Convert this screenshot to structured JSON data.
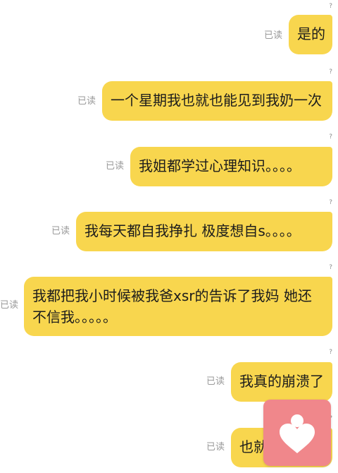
{
  "messages": [
    {
      "mark": "?",
      "status": "已读",
      "text": "是的"
    },
    {
      "mark": "?",
      "status": "已读",
      "text": "一个星期我也就也能见到我奶一次"
    },
    {
      "mark": "?",
      "status": "已读",
      "text": "我姐都学过心理知识。。。。"
    },
    {
      "mark": "?",
      "status": "已读",
      "text": "我每天都自我挣扎 极度想自s。。。。"
    },
    {
      "mark": "?",
      "status": "已读",
      "text": "我都把我小时候被我爸xsr的告诉了我妈 她还不信我。。。。。"
    },
    {
      "mark": "?",
      "status": "已读",
      "text": "我真的崩溃了"
    },
    {
      "mark": "?",
      "status": "已读",
      "text": "也就"
    }
  ],
  "overlay": {
    "icon": "heart-icon",
    "color": "#f0878b"
  },
  "colors": {
    "bubble": "#f8d64e",
    "status": "#9a9a9a"
  }
}
